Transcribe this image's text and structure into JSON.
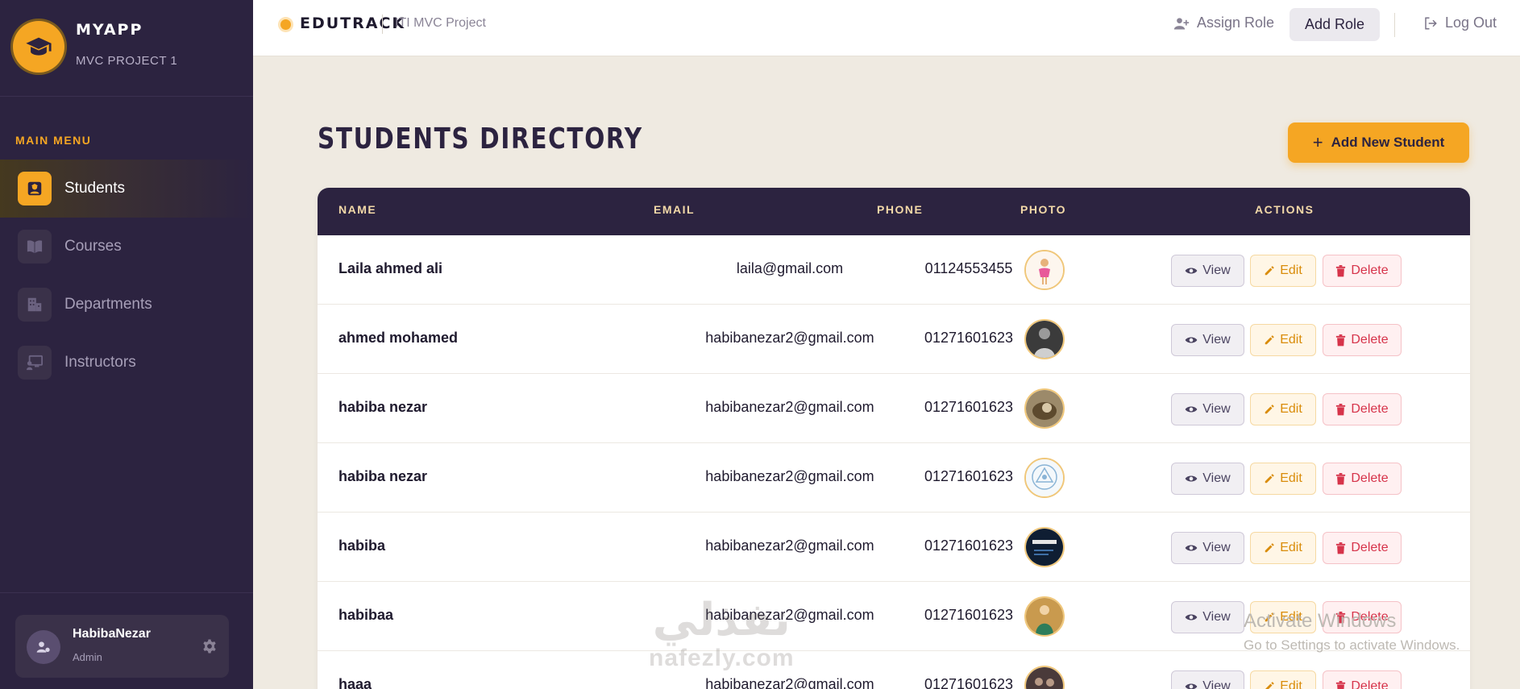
{
  "sidebar": {
    "app_name": "MYAPP",
    "app_subtitle": "MVC PROJECT 1",
    "menu_heading": "MAIN MENU",
    "items": [
      {
        "label": "Students",
        "icon": "student-icon",
        "active": true
      },
      {
        "label": "Courses",
        "icon": "book-icon",
        "active": false
      },
      {
        "label": "Departments",
        "icon": "building-icon",
        "active": false
      },
      {
        "label": "Instructors",
        "icon": "chalkboard-icon",
        "active": false
      }
    ],
    "user": {
      "name": "HabibaNezar",
      "role": "Admin"
    }
  },
  "topbar": {
    "brand": "EDUTRACK",
    "project": "ITI MVC Project",
    "assign_role": "Assign Role",
    "add_role": "Add Role",
    "logout": "Log Out"
  },
  "main": {
    "title": "STUDENTS DIRECTORY",
    "add_button": "Add New Student",
    "columns": [
      "NAME",
      "EMAIL",
      "PHONE",
      "PHOTO",
      "ACTIONS"
    ],
    "actions": {
      "view": "View",
      "edit": "Edit",
      "delete": "Delete"
    },
    "rows": [
      {
        "name": "Laila ahmed ali",
        "email": "laila@gmail.com",
        "phone": "01124553455"
      },
      {
        "name": "ahmed mohamed",
        "email": "habibanezar2@gmail.com",
        "phone": "01271601623"
      },
      {
        "name": "habiba nezar",
        "email": "habibanezar2@gmail.com",
        "phone": "01271601623"
      },
      {
        "name": "habiba nezar",
        "email": "habibanezar2@gmail.com",
        "phone": "01271601623"
      },
      {
        "name": "habiba",
        "email": "habibanezar2@gmail.com",
        "phone": "01271601623"
      },
      {
        "name": "habibaa",
        "email": "habibanezar2@gmail.com",
        "phone": "01271601623"
      },
      {
        "name": "haaa",
        "email": "habibanezar2@gmail.com",
        "phone": "01271601623"
      }
    ]
  },
  "overlay": {
    "activate_title": "Activate Windows",
    "activate_sub": "Go to Settings to activate Windows.",
    "watermark_arabic": "نفذلي",
    "watermark_url": "nafezly.com"
  },
  "colors": {
    "sidebar_bg": "#2c2340",
    "accent": "#f5a623",
    "page_bg": "#efeae1",
    "danger": "#d6334a"
  }
}
